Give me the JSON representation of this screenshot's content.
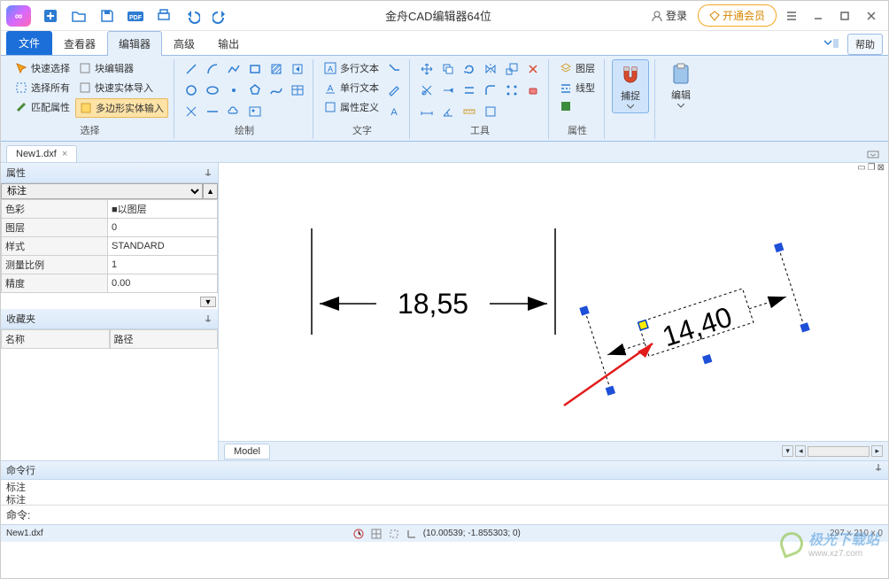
{
  "app": {
    "title": "金舟CAD编辑器64位",
    "logo_text": "∞"
  },
  "titlebar": {
    "login": "登录",
    "vip": "开通会员"
  },
  "tabs": {
    "file": "文件",
    "viewer": "查看器",
    "editor": "编辑器",
    "advanced": "高级",
    "output": "输出",
    "help": "帮助"
  },
  "ribbon": {
    "select": {
      "label": "选择",
      "quick_select": "快速选择",
      "select_all": "选择所有",
      "match_prop": "匹配属性",
      "block_editor": "块编辑器",
      "quick_entity_import": "快速实体导入",
      "poly_entity_input": "多边形实体输入"
    },
    "draw": {
      "label": "绘制"
    },
    "text": {
      "label": "文字",
      "mtext": "多行文本",
      "stext": "单行文本",
      "attr_def": "属性定义"
    },
    "tools": {
      "label": "工具"
    },
    "props": {
      "label": "属性",
      "layer": "图层",
      "linetype": "线型"
    },
    "snap": {
      "label": "捕捉"
    },
    "edit": {
      "label": "编辑"
    }
  },
  "doc": {
    "tab1": "New1.dxf"
  },
  "prop_panel": {
    "title": "属性",
    "object_type": "标注",
    "rows": {
      "color": {
        "k": "色彩",
        "v": "■以图层"
      },
      "layer": {
        "k": "图层",
        "v": "0"
      },
      "style": {
        "k": "样式",
        "v": "STANDARD"
      },
      "scale": {
        "k": "测量比例",
        "v": "1"
      },
      "precision": {
        "k": "精度",
        "v": "0.00"
      }
    }
  },
  "fav_panel": {
    "title": "收藏夹",
    "col_name": "名称",
    "col_path": "路径"
  },
  "canvas": {
    "dims": {
      "d1": "18,55",
      "d2": "14,40"
    },
    "model_tab": "Model"
  },
  "cmd": {
    "title": "命令行",
    "history1": "标注",
    "history2": "标注",
    "prompt": "命令:"
  },
  "status": {
    "file": "New1.dxf",
    "coords": "(10.00539; -1.855303; 0)",
    "dims": "297 x 210 x 0"
  },
  "placeholders": {
    "cmd_input": ""
  }
}
